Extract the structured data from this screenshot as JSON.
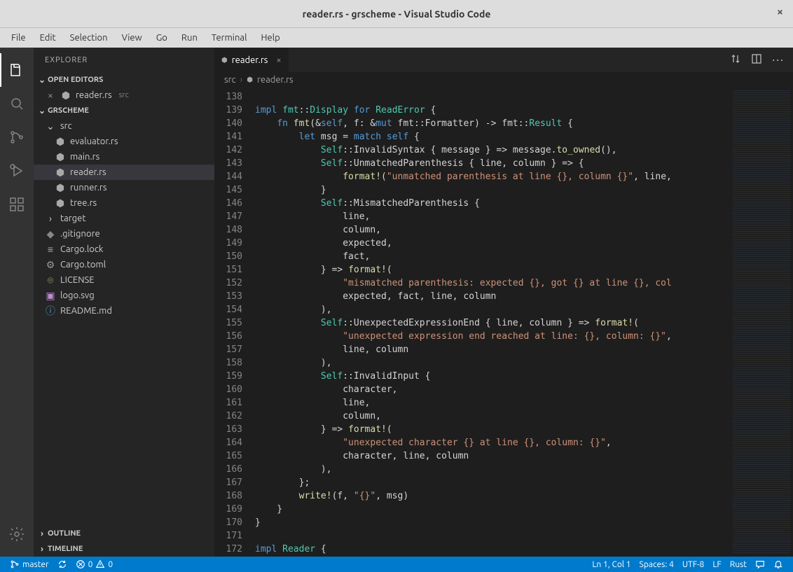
{
  "window": {
    "title": "reader.rs - grscheme - Visual Studio Code"
  },
  "menu": [
    "File",
    "Edit",
    "Selection",
    "View",
    "Go",
    "Run",
    "Terminal",
    "Help"
  ],
  "sidebar": {
    "title": "EXPLORER",
    "openEditors": {
      "label": "OPEN EDITORS",
      "items": [
        {
          "name": "reader.rs",
          "desc": "src"
        }
      ]
    },
    "project": {
      "label": "GRSCHEME",
      "tree": [
        {
          "type": "folder",
          "name": "src",
          "depth": 1,
          "expanded": true
        },
        {
          "type": "file",
          "name": "evaluator.rs",
          "depth": 2,
          "icon": "rust"
        },
        {
          "type": "file",
          "name": "main.rs",
          "depth": 2,
          "icon": "rust"
        },
        {
          "type": "file",
          "name": "reader.rs",
          "depth": 2,
          "icon": "rust",
          "active": true
        },
        {
          "type": "file",
          "name": "runner.rs",
          "depth": 2,
          "icon": "rust"
        },
        {
          "type": "file",
          "name": "tree.rs",
          "depth": 2,
          "icon": "rust"
        },
        {
          "type": "folder",
          "name": "target",
          "depth": 1,
          "expanded": false
        },
        {
          "type": "file",
          "name": ".gitignore",
          "depth": 1,
          "icon": "git"
        },
        {
          "type": "file",
          "name": "Cargo.lock",
          "depth": 1,
          "icon": "lock"
        },
        {
          "type": "file",
          "name": "Cargo.toml",
          "depth": 1,
          "icon": "toml"
        },
        {
          "type": "file",
          "name": "LICENSE",
          "depth": 1,
          "icon": "license"
        },
        {
          "type": "file",
          "name": "logo.svg",
          "depth": 1,
          "icon": "svg"
        },
        {
          "type": "file",
          "name": "README.md",
          "depth": 1,
          "icon": "md"
        }
      ]
    },
    "outline": "OUTLINE",
    "timeline": "TIMELINE"
  },
  "tabs": [
    {
      "label": "reader.rs",
      "active": true
    }
  ],
  "breadcrumbs": [
    "src",
    "reader.rs"
  ],
  "editor": {
    "startLine": 138,
    "lines": [
      "",
      "<kw>impl</kw> <type>fmt</type>::<type>Display</type> <kw>for</kw> <type>ReadError</type> {",
      "    <kw>fn</kw> <fn>fmt</fn>(&<self>self</self>, f: &<mut>mut</mut> fmt::Formatter) -> fmt::<type>Result</type> {",
      "        <kw>let</kw> msg = <kw>match</kw> <self>self</self> {",
      "            <type>Self</type>::InvalidSyntax { message } => message.<fn>to_owned</fn>(),",
      "            <type>Self</type>::UnmatchedParenthesis { line, column } => {",
      "                <macro>format!</macro>(<str>\"unmatched parenthesis at line {}, column {}\"</str>, line,",
      "            }",
      "            <type>Self</type>::MismatchedParenthesis {",
      "                line,",
      "                column,",
      "                expected,",
      "                fact,",
      "            } => <macro>format!</macro>(",
      "                <str>\"mismatched parenthesis: expected {}, got {} at line {}, col</str>",
      "                expected, fact, line, column",
      "            ),",
      "            <type>Self</type>::UnexpectedExpressionEnd { line, column } => <macro>format!</macro>(",
      "                <str>\"unexpected expression end reached at line: {}, column: {}\"</str>,",
      "                line, column",
      "            ),",
      "            <type>Self</type>::InvalidInput {",
      "                character,",
      "                line,",
      "                column,",
      "            } => <macro>format!</macro>(",
      "                <str>\"unexpected character {} at line {}, column: {}\"</str>,",
      "                character, line, column",
      "            ),",
      "        };",
      "        <macro>write!</macro>(f, <str>\"{}\"</str>, msg)",
      "    }",
      "}",
      "",
      "<kw>impl</kw> <type>Reader</type> {"
    ]
  },
  "status": {
    "branch": "master",
    "errors": "0",
    "warnings": "0",
    "cursor": "Ln 1, Col 1",
    "spaces": "Spaces: 4",
    "encoding": "UTF-8",
    "eol": "LF",
    "lang": "Rust"
  }
}
